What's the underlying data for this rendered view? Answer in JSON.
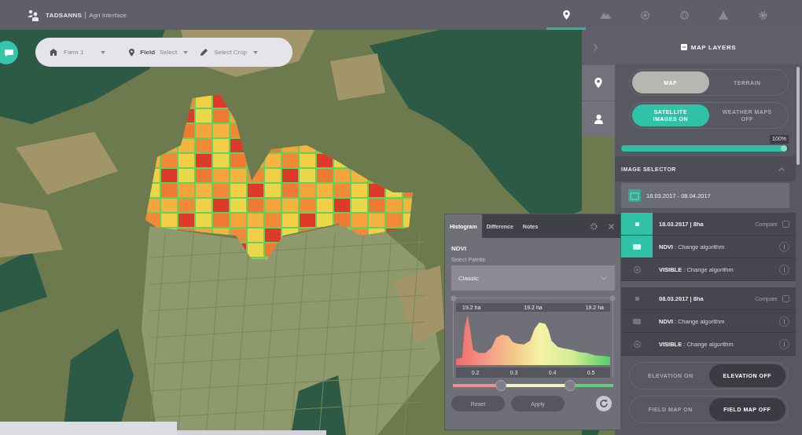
{
  "top_bar": {
    "brand": "TADSANNS",
    "subtitle": "Agri Interface",
    "nav_tabs": [
      {
        "selected": true
      },
      {
        "selected": false
      },
      {
        "selected": false
      },
      {
        "selected": false
      },
      {
        "selected": false
      },
      {
        "selected": false
      }
    ]
  },
  "toolbar": {
    "farm": "Farm 1",
    "field_label": "Field",
    "field_value": "Select",
    "crop": "Select Crop"
  },
  "map_layers": {
    "title": "MAP LAYERS",
    "toggles": [
      {
        "kind": "neutral",
        "options": [
          {
            "label": "MAP",
            "selected": true
          },
          {
            "label": "TERRAIN",
            "selected": false
          }
        ]
      },
      {
        "kind": "accent",
        "options": [
          {
            "label": "SATELLITE IMAGES ON",
            "selected": true
          },
          {
            "label": "WEATHER MAPS OFF",
            "selected": false
          }
        ]
      }
    ],
    "opacity": {
      "level": 0.97,
      "reading": "100%"
    }
  },
  "image_selector": {
    "title": "IMAGE SELECTOR",
    "date_range": "18.03.2017 - 08.04.2017",
    "groups": [
      {
        "title": "18.03.2017 | 8ha",
        "action": "Compare",
        "selected": true,
        "layers": [
          {
            "label": "**NDVI** : Change algorithm",
            "selected": true
          },
          {
            "label": "**VISIBLE** : Change algorithm",
            "selected": false
          }
        ]
      },
      {
        "title": "08.03.2017 | 8ha",
        "action": "Compare",
        "selected": false,
        "layers": [
          {
            "label": "**NDVI** : Change algorithm",
            "selected": false
          },
          {
            "label": "**VISIBLE** : Change algorithm",
            "selected": false
          }
        ]
      }
    ]
  },
  "bottom_toggles": [
    {
      "kind": "dark",
      "options": [
        {
          "label": "ELEVATION ON",
          "selected": false
        },
        {
          "label": "ELEVATION OFF",
          "selected": true
        }
      ]
    },
    {
      "kind": "dark",
      "options": [
        {
          "label": "FIELD MAP ON",
          "selected": false
        },
        {
          "label": "FIELD MAP OFF",
          "selected": true
        }
      ]
    }
  ],
  "histogram_panel": {
    "tabs": [
      {
        "label": "Histogram",
        "selected": true
      },
      {
        "label": "Difference",
        "selected": false
      },
      {
        "label": "Notes",
        "selected": false
      }
    ],
    "index": "NDVI",
    "palette_label": "Select Palette",
    "palette": "Classic",
    "area_labels": [
      "19.2 ha",
      "19.2 ha",
      "19.2 ha"
    ],
    "x_labels": [
      "0.2",
      "0.3",
      "0.4",
      "0.5"
    ],
    "range_handles": [
      {
        "level": 0.3
      },
      {
        "level": 0.73
      }
    ],
    "buttons": [
      "Reset",
      "Apply"
    ]
  }
}
